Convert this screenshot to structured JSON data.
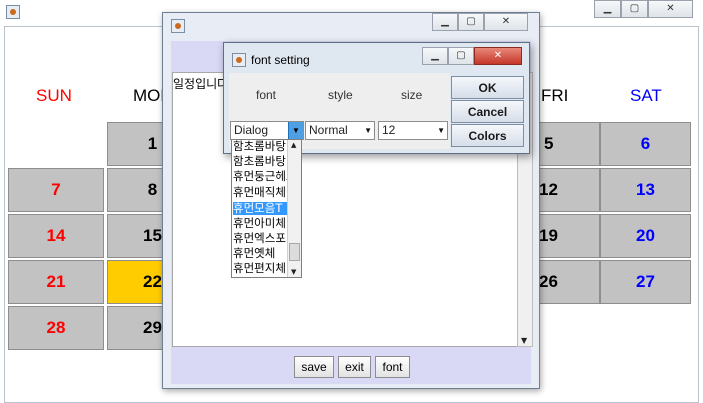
{
  "calendar": {
    "day_headers": [
      {
        "label": "SUN",
        "color": "#ff0000"
      },
      {
        "label": "MON",
        "color": "#000000"
      },
      {
        "label": "FRI",
        "color": "#000000"
      },
      {
        "label": "SAT",
        "color": "#0000ff"
      }
    ],
    "cells": {
      "d1": "1",
      "d5": "5",
      "d6": "6",
      "d7": "7",
      "d8": "8",
      "d12": "12",
      "d13": "13",
      "d14": "14",
      "d15": "15",
      "d19": "19",
      "d20": "20",
      "d21": "21",
      "d22": "22",
      "d26": "26",
      "d27": "27",
      "d28": "28",
      "d29": "29"
    },
    "today_color": "#ffcc00"
  },
  "schedule_window": {
    "text": "일정입니다",
    "buttons": {
      "save": "save",
      "exit": "exit",
      "font": "font"
    }
  },
  "font_dialog": {
    "title": "font setting",
    "labels": {
      "font": "font",
      "style": "style",
      "size": "size"
    },
    "font_value": "Dialog",
    "style_value": "Normal",
    "size_value": "12",
    "buttons": {
      "ok": "OK",
      "cancel": "Cancel",
      "colors": "Colors"
    },
    "font_options": [
      "함초롬바탕",
      "함초롬바탕",
      "휴먼둥근헤드라인",
      "휴먼매직체",
      "휴먼모음T",
      "휴먼아미체",
      "휴먼엑스포",
      "휴먼옛체",
      "휴먼편지체"
    ],
    "selected_option_index": 4
  },
  "icons": {
    "title_icon": "java-cup-icon",
    "minimize": "minimize-icon",
    "maximize": "maximize-icon",
    "close": "close-icon"
  }
}
